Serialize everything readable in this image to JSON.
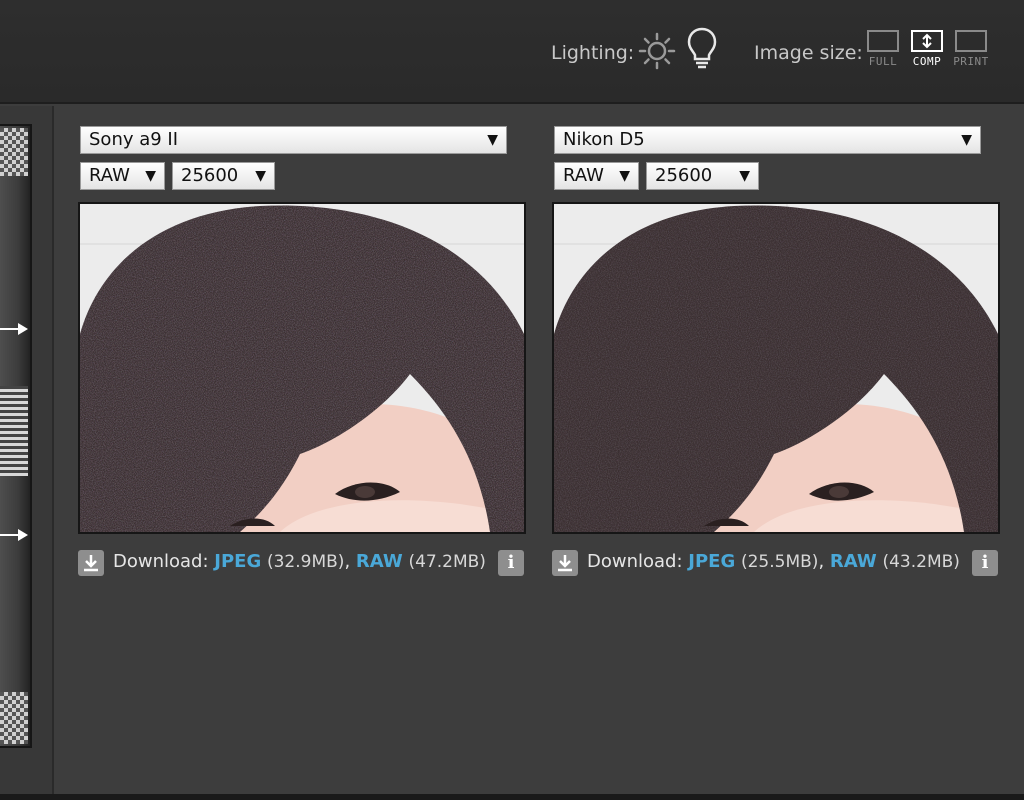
{
  "toolbar": {
    "lighting_label": "Lighting:",
    "lighting_icons": [
      "sun-icon",
      "bulb-icon"
    ],
    "image_size_label": "Image size:",
    "size_options": [
      {
        "label": "FULL",
        "active": false
      },
      {
        "label": "COMP",
        "active": true
      },
      {
        "label": "PRINT",
        "active": false
      }
    ]
  },
  "panels": [
    {
      "camera": "Sony a9 II",
      "format": "RAW",
      "iso": "25600",
      "download_label": "Download:",
      "jpeg_label": "JPEG",
      "jpeg_size": "(32.9MB)",
      "raw_label": "RAW",
      "raw_size": "(47.2MB)",
      "info_label": "i"
    },
    {
      "camera": "Nikon D5",
      "format": "RAW",
      "iso": "25600",
      "download_label": "Download:",
      "jpeg_label": "JPEG",
      "jpeg_size": "(25.5MB)",
      "raw_label": "RAW",
      "raw_size": "(43.2MB)",
      "info_label": "i"
    }
  ],
  "colors": {
    "link": "#4aa8d8",
    "background": "#3d3d3d",
    "toolbar": "#2c2c2c"
  }
}
